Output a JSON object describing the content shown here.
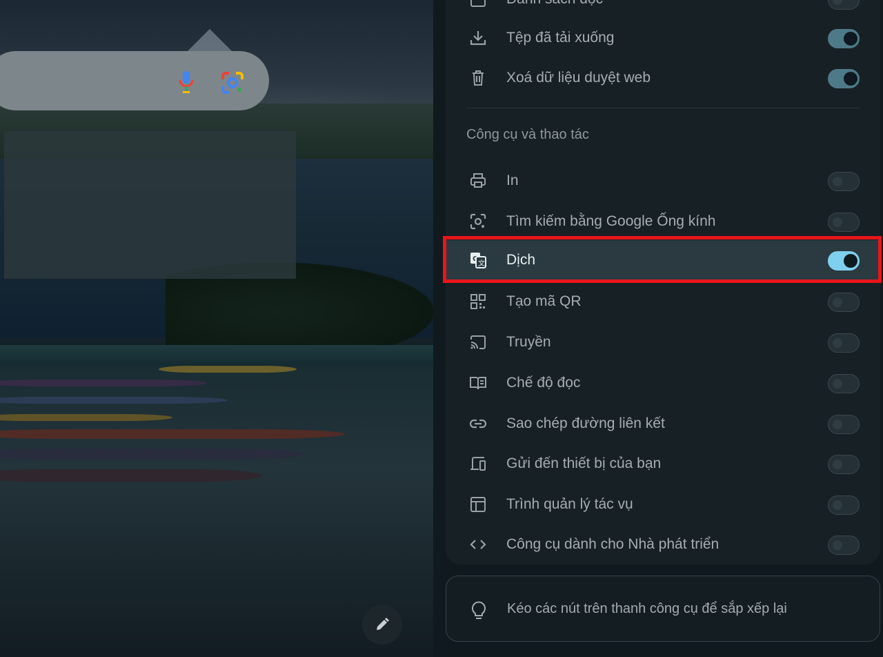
{
  "ntp": {
    "search_icons": [
      "mic-icon",
      "lens-icon"
    ],
    "edit_button_icon": "pencil-icon"
  },
  "panel": {
    "top_partial_label": "Danh sách đọc",
    "items_top": [
      {
        "label": "Tệp đã tải xuống",
        "icon": "download-icon",
        "enabled": true
      },
      {
        "label": "Xoá dữ liệu duyệt web",
        "icon": "trash-icon",
        "enabled": true
      }
    ],
    "section_title": "Công cụ và thao tác",
    "tools": [
      {
        "label": "In",
        "icon": "print-icon",
        "enabled": false
      },
      {
        "label": "Tìm kiếm bằng Google Ống kính",
        "icon": "lens-search-icon",
        "enabled": false
      },
      {
        "label": "Dịch",
        "icon": "translate-icon",
        "enabled": true,
        "highlighted": true
      },
      {
        "label": "Tạo mã QR",
        "icon": "qr-icon",
        "enabled": false
      },
      {
        "label": "Truyền",
        "icon": "cast-icon",
        "enabled": false
      },
      {
        "label": "Chế độ đọc",
        "icon": "book-icon",
        "enabled": false
      },
      {
        "label": "Sao chép đường liên kết",
        "icon": "link-icon",
        "enabled": false
      },
      {
        "label": "Gửi đến thiết bị của bạn",
        "icon": "devices-icon",
        "enabled": false
      },
      {
        "label": "Trình quản lý tác vụ",
        "icon": "task-manager-icon",
        "enabled": false
      },
      {
        "label": "Công cụ dành cho Nhà phát triển",
        "icon": "code-icon",
        "enabled": false
      }
    ],
    "hint": {
      "text": "Kéo các nút trên thanh công cụ để sắp xếp lại",
      "icon": "lightbulb-icon"
    }
  },
  "colors": {
    "highlight_frame": "#e8151b",
    "toggle_on": "#4e7a88",
    "toggle_active": "#7fd0ee"
  }
}
